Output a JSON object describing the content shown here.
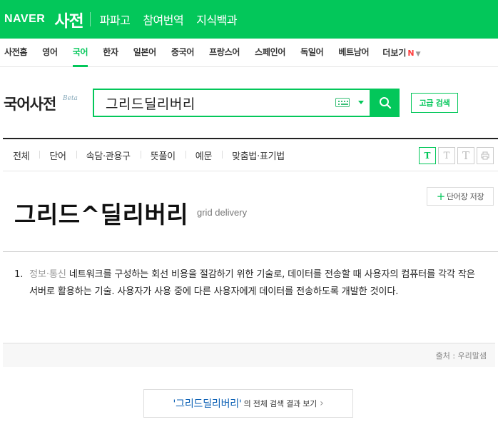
{
  "top_bar": {
    "logo": "NAVER",
    "service": "사전",
    "nav": [
      "파파고",
      "참여번역",
      "지식백과"
    ]
  },
  "sub_nav": {
    "items": [
      "사전홈",
      "영어",
      "국어",
      "한자",
      "일본어",
      "중국어",
      "프랑스어",
      "스페인어",
      "독일어",
      "베트남어"
    ],
    "active": "국어",
    "more_label": "더보기",
    "new_badge": "N"
  },
  "search": {
    "dict_title": "국어사전",
    "beta_label": "Beta",
    "query": "그리드딜리버리",
    "advanced_label": "고급 검색"
  },
  "filters": {
    "items": [
      "전체",
      "단어",
      "속담·관용구",
      "뜻풀이",
      "예문",
      "맞춤법·표기법"
    ],
    "font_buttons": [
      "T",
      "T",
      "T"
    ]
  },
  "entry": {
    "save_label": "단어장 저장",
    "headword": "그리드^딜리버리",
    "origin": "grid delivery",
    "definitions": [
      {
        "number": "1.",
        "category": "정보·통신",
        "text": "네트워크를 구성하는 회선 비용을 절감하기 위한 기술로, 데이터를 전송할 때 사용자의 컴퓨터를 각각 작은 서버로 활용하는 기술. 사용자가 사용 중에 다른 사용자에게 데이터를 전송하도록 개발한 것이다."
      }
    ],
    "source": "출처 : 우리말샘"
  },
  "full_search": {
    "query": "'그리드딜리버리'",
    "suffix": "의 전체 검색 결과 보기",
    "chevron": "›"
  },
  "colors": {
    "brand_green": "#03c75a",
    "link_blue": "#0a5fb4"
  }
}
